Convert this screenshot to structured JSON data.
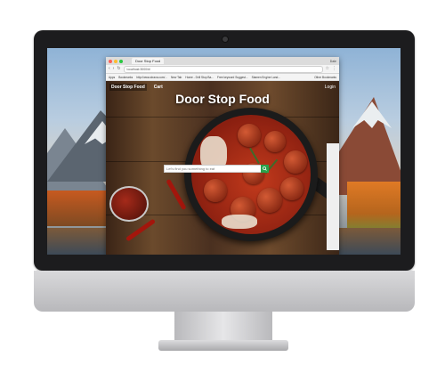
{
  "browser": {
    "tab_title": "Door Stop Food",
    "user": "Dale",
    "url": "localhost:3000/#/",
    "bookmarks": [
      "Apps",
      "Bookmarks",
      "http://www.strava.com/...",
      "New Tab",
      "Home - Drill Stop Ba...",
      "Free keyword Suggest...",
      "Stamen Engine Land..."
    ],
    "bookmarks_right": "Other Bookmarks"
  },
  "site": {
    "nav": {
      "brand": "Door Stop Food",
      "cart": "Cart",
      "login": "Login"
    },
    "hero_title": "Door Stop Food",
    "search": {
      "placeholder": "Let's find you something to eat",
      "icon": "search-icon"
    }
  },
  "colors": {
    "search_button": "#2aa14b",
    "hero_text": "#ffffff"
  }
}
